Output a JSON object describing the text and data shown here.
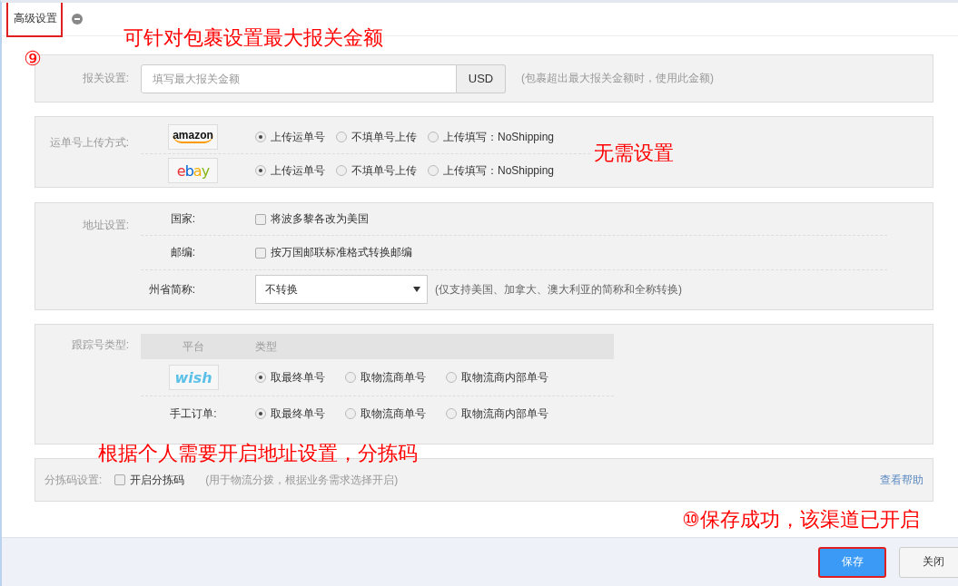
{
  "title": {
    "text": "高级设置",
    "highlighted": true
  },
  "customs": {
    "label": "报关设置:",
    "placeholder": "填写最大报关金额",
    "currency": "USD",
    "hint": "(包裹超出最大报关金额时，使用此金额)"
  },
  "upload": {
    "label": "运单号上传方式:",
    "rows": [
      {
        "logo": {
          "kind": "amazon",
          "text": "amazon"
        },
        "options": [
          {
            "label": "上传运单号",
            "selected": true
          },
          {
            "label": "不填单号上传",
            "selected": false
          },
          {
            "label": "上传填写：NoShipping",
            "selected": false
          }
        ]
      },
      {
        "logo": {
          "kind": "ebay",
          "text": "ebay"
        },
        "options": [
          {
            "label": "上传运单号",
            "selected": true
          },
          {
            "label": "不填单号上传",
            "selected": false
          },
          {
            "label": "上传填写：NoShipping",
            "selected": false
          }
        ]
      }
    ]
  },
  "address": {
    "label": "地址设置:",
    "rows": [
      {
        "kind": "checkbox",
        "label": "国家:",
        "option": "将波多黎各改为美国",
        "checked": false
      },
      {
        "kind": "checkbox",
        "label": "邮编:",
        "option": "按万国邮联标准格式转换邮编",
        "checked": false
      },
      {
        "kind": "select",
        "label": "州省简称:",
        "value": "不转换",
        "hint": "(仅支持美国、加拿大、澳大利亚的简称和全称转换)"
      }
    ]
  },
  "tracking": {
    "label": "跟踪号类型:",
    "columns": [
      "平台",
      "类型"
    ],
    "rows": [
      {
        "kind": "logo",
        "logo": {
          "kind": "wish",
          "text": "wish"
        },
        "options": [
          {
            "label": "取最终单号",
            "selected": true
          },
          {
            "label": "取物流商单号",
            "selected": false
          },
          {
            "label": "取物流商内部单号",
            "selected": false
          }
        ]
      },
      {
        "kind": "text",
        "platform": "手工订单:",
        "options": [
          {
            "label": "取最终单号",
            "selected": true
          },
          {
            "label": "取物流商单号",
            "selected": false
          },
          {
            "label": "取物流商内部单号",
            "selected": false
          }
        ]
      }
    ]
  },
  "sorting": {
    "label": "分拣码设置:",
    "option": "开启分拣码",
    "checked": false,
    "hint": "(用于物流分拨，根据业务需求选择开启)",
    "help": "查看帮助"
  },
  "buttons": [
    {
      "kind": "primary",
      "label": "保存",
      "highlighted": true
    },
    {
      "kind": "default",
      "label": "关闭",
      "highlighted": false
    }
  ],
  "annotations": [
    "⑨",
    "可针对包裹设置最大报关金额",
    "无需设置",
    "根据个人需要开启地址设置，分拣码",
    "⑩保存成功，该渠道已开启"
  ]
}
